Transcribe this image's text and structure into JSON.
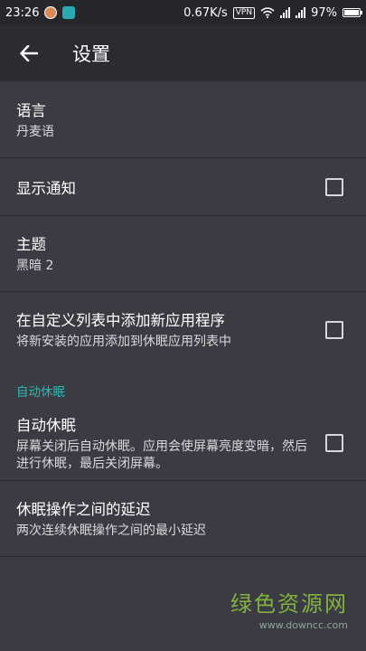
{
  "status_bar": {
    "time": "23:26",
    "net_speed": "0.67K/s",
    "vpn": "VPN",
    "battery": "97%",
    "battery_level": 0.97
  },
  "app_bar": {
    "title": "设置"
  },
  "settings": {
    "language": {
      "title": "语言",
      "summary": "丹麦语"
    },
    "show_notification": {
      "title": "显示通知",
      "checked": false
    },
    "theme": {
      "title": "主题",
      "summary": "黑暗 2"
    },
    "add_new_apps": {
      "title": "在自定义列表中添加新应用程序",
      "summary": "将新安装的应用添加到休眠应用列表中",
      "checked": false
    },
    "section_auto_sleep": "自动休眠",
    "auto_sleep": {
      "title": "自动休眠",
      "summary": "屏幕关闭后自动休眠。应用会使屏幕亮度变暗，然后进行休眠，最后关闭屏幕。",
      "checked": false
    },
    "delay": {
      "title": "休眠操作之间的延迟",
      "summary": "两次连续休眠操作之间的最小延迟"
    }
  },
  "watermark": {
    "main": "绿色资源网",
    "sub": "www.downcc.com"
  },
  "colors": {
    "background": "#3b3c43",
    "app_bar": "#2b2c31",
    "accent": "#31b7b0"
  }
}
